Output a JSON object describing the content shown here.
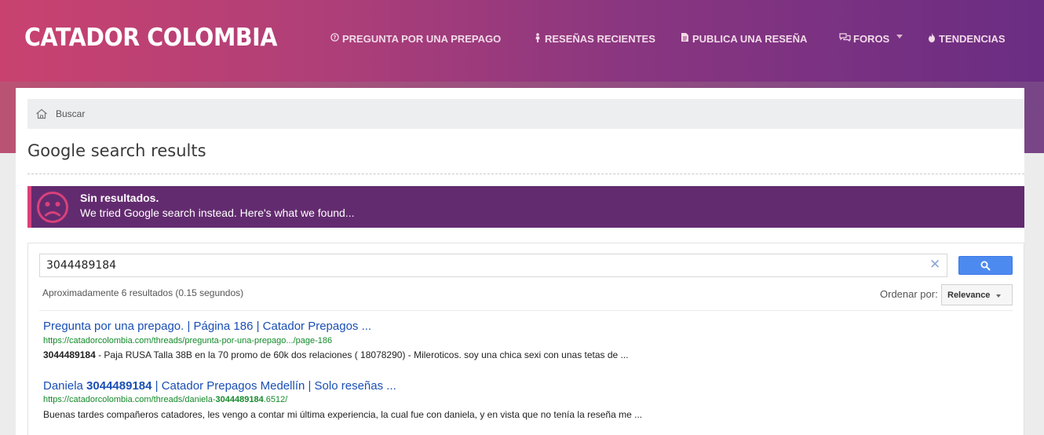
{
  "header": {
    "logo": "CATADOR COLOMBIA",
    "nav": [
      {
        "icon": "question-circle-icon",
        "label": "PREGUNTA POR UNA PREPAGO"
      },
      {
        "icon": "female-icon",
        "label": "RESEÑAS RECIENTES"
      },
      {
        "icon": "file-icon",
        "label": "PUBLICA UNA RESEÑA"
      },
      {
        "icon": "comments-icon",
        "label": "FOROS"
      },
      {
        "icon": "fire-icon",
        "label": "TENDENCIAS"
      }
    ]
  },
  "breadcrumb": {
    "label": "Buscar"
  },
  "page": {
    "title": "Google search results"
  },
  "notice": {
    "title": "Sin resultados.",
    "message": "We tried Google search instead. Here's what we found..."
  },
  "search": {
    "query": "3044489184",
    "results_info": "Aproximadamente 6 resultados (0.15 segundos)",
    "order_label": "Ordenar por:",
    "order_value": "Relevance"
  },
  "results": [
    {
      "title": "Pregunta por una prepago. | Página 186 | Catador Prepagos ...",
      "url": "https://catadorcolombia.com/threads/pregunta-por-una-prepago.../page-186",
      "snippet_bold": "3044489184",
      "snippet": " - Paja RUSA Talla 38B en la 70 promo de 60k dos relaciones ( 18078290) - Mileroticos. soy una chica sexi con unas tetas de ..."
    },
    {
      "title_pre": "Daniela ",
      "title_bold": "3044489184",
      "title_post": " | Catador Prepagos Medellín | Solo reseñas ...",
      "url_pre": "https://catadorcolombia.com/threads/daniela-",
      "url_bold": "3044489184",
      "url_post": ".6512/",
      "snippet": "Buenas tardes compañeros catadores, les vengo a contar mi última experiencia, la cual fue con daniela, y en vista que no tenía la reseña me ..."
    }
  ],
  "colors": {
    "header_start": "#c9426f",
    "header_end": "#6a2d83",
    "notice_bg": "#632b6f",
    "notice_accent": "#d8417a",
    "link": "#1a4fb4",
    "url": "#138a2a",
    "search_button": "#4d8af0"
  }
}
